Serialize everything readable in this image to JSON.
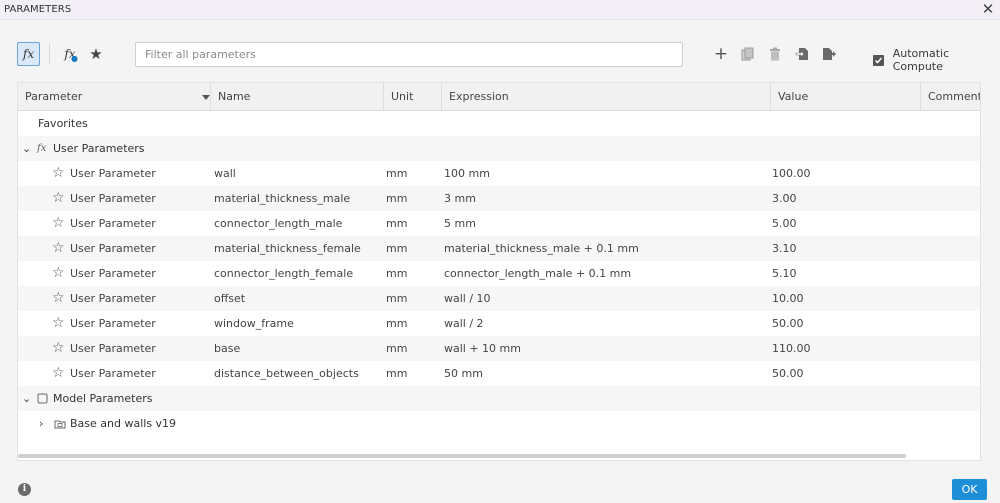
{
  "window": {
    "title": "PARAMETERS"
  },
  "toolbar": {
    "filter_placeholder": "Filter all parameters",
    "auto_compute_label": "Automatic Compute",
    "auto_compute_checked": true
  },
  "table": {
    "columns": [
      "Parameter",
      "Name",
      "Unit",
      "Expression",
      "Value",
      "Comments"
    ],
    "favorites_label": "Favorites",
    "user_group_label": "User Parameters",
    "rows": [
      {
        "type": "User Parameter",
        "name": "wall",
        "unit": "mm",
        "expression": "100 mm",
        "value": "100.00"
      },
      {
        "type": "User Parameter",
        "name": "material_thickness_male",
        "unit": "mm",
        "expression": "3 mm",
        "value": "3.00"
      },
      {
        "type": "User Parameter",
        "name": "connector_length_male",
        "unit": "mm",
        "expression": "5 mm",
        "value": "5.00"
      },
      {
        "type": "User Parameter",
        "name": "material_thickness_female",
        "unit": "mm",
        "expression": "material_thickness_male + 0.1 mm",
        "value": "3.10"
      },
      {
        "type": "User Parameter",
        "name": "connector_length_female",
        "unit": "mm",
        "expression": "connector_length_male + 0.1 mm",
        "value": "5.10"
      },
      {
        "type": "User Parameter",
        "name": "offset",
        "unit": "mm",
        "expression": "wall / 10",
        "value": "10.00"
      },
      {
        "type": "User Parameter",
        "name": "window_frame",
        "unit": "mm",
        "expression": "wall / 2",
        "value": "50.00"
      },
      {
        "type": "User Parameter",
        "name": "base",
        "unit": "mm",
        "expression": "wall + 10 mm",
        "value": "110.00"
      },
      {
        "type": "User Parameter",
        "name": "distance_between_objects",
        "unit": "mm",
        "expression": "50 mm",
        "value": "50.00"
      }
    ],
    "model_group_label": "Model Parameters",
    "model_child_label": "Base and walls v19"
  },
  "footer": {
    "ok_label": "OK"
  },
  "colors": {
    "accent": "#1e8ed6",
    "header_bg": "#f1f1f1",
    "title_bg": "#f3eff6"
  }
}
